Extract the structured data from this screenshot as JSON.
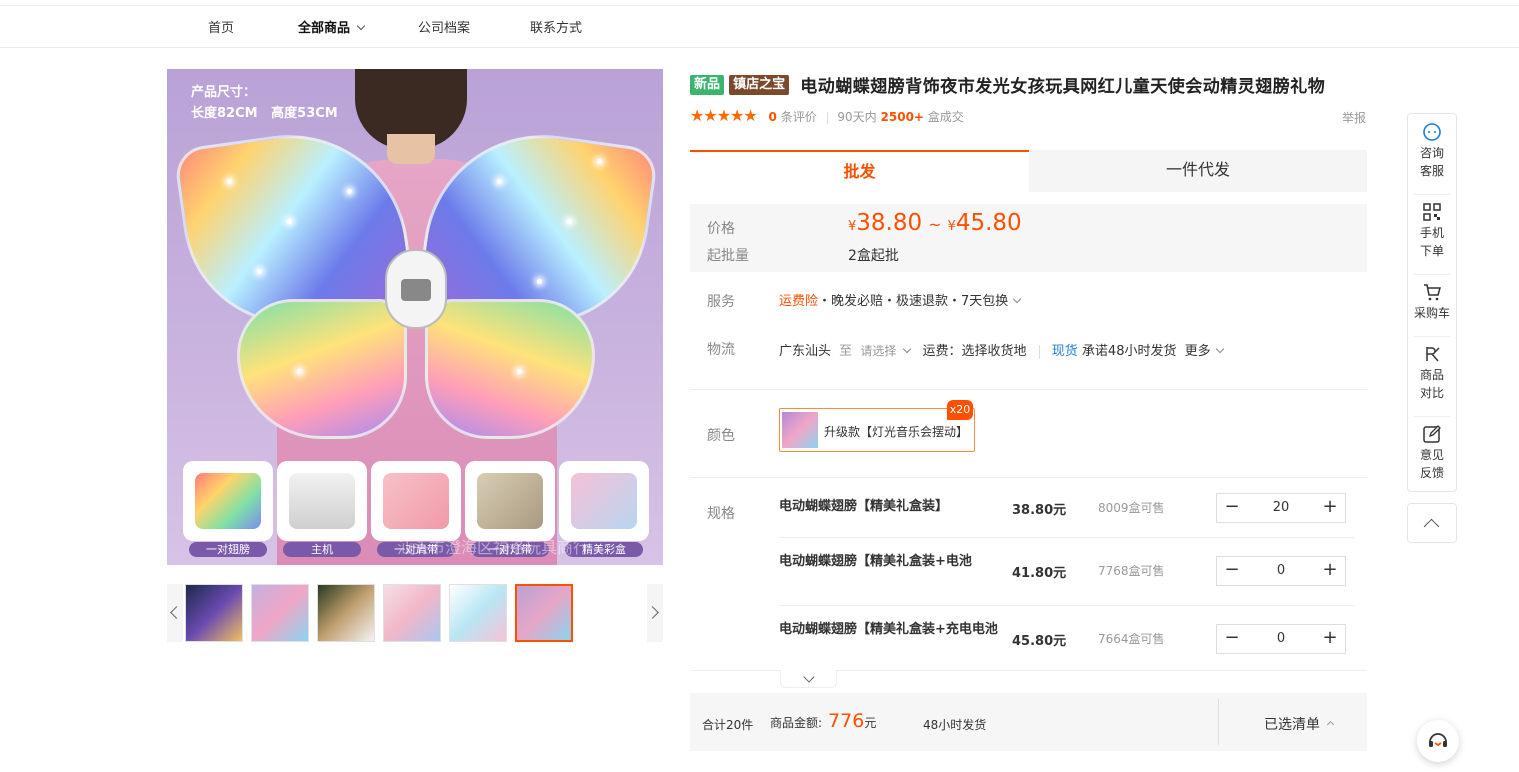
{
  "nav": {
    "items": [
      "首页",
      "全部商品",
      "公司档案",
      "联系方式"
    ]
  },
  "image": {
    "size_title": "产品尺寸：",
    "size_values": "长度82CM   高度53CM",
    "sub_labels": [
      "一对翅膀",
      "主机",
      "一对肩带",
      "一对灯带",
      "精美彩盒"
    ],
    "watermark": "汕头市澄海区福洛玩具商行"
  },
  "product": {
    "badge_new": "新品",
    "badge_treasure": "镇店之宝",
    "title": "电动蝴蝶翅膀背饰夜市发光女孩玩具网红儿童天使会动精灵翅膀礼物",
    "stars": "★★★★★",
    "review_count": "0",
    "review_label": "条评价",
    "sales_prefix": "90天内",
    "sales_count": "2500+",
    "sales_suffix": "盒成交",
    "report": "举报"
  },
  "tabs": [
    "批发",
    "一件代发"
  ],
  "price": {
    "label": "价格",
    "currency": "¥",
    "low": "38.80",
    "tilde": "~",
    "high": "45.80",
    "moq_label": "起批量",
    "moq_value": "2盒起批"
  },
  "service": {
    "label": "服务",
    "highlight": "运费险",
    "rest": "・晚发必赔・极速退款・7天包换"
  },
  "logistics": {
    "label": "物流",
    "origin": "广东汕头",
    "to": "至",
    "select": "请选择",
    "freight": "运费：选择收货地",
    "stock": "现货",
    "promise": "承诺48小时发货",
    "more": "更多"
  },
  "color": {
    "label": "颜色",
    "option": "升级款【灯光音乐会摆动】",
    "qty_badge": "x20"
  },
  "spec": {
    "label": "规格",
    "rows": [
      {
        "name": "电动蝴蝶翅膀【精美礼盒装】",
        "price": "38.80元",
        "stock": "8009盒可售",
        "qty": "20"
      },
      {
        "name": "电动蝴蝶翅膀【精美礼盒装+电池",
        "price": "41.80元",
        "stock": "7768盒可售",
        "qty": "0"
      },
      {
        "name": "电动蝴蝶翅膀【精美礼盒装+充电电池",
        "price": "45.80元",
        "stock": "7664盒可售",
        "qty": "0"
      }
    ],
    "minus": "−",
    "plus": "+"
  },
  "summary": {
    "total_items": "合计20件",
    "amount_label": "商品金额:",
    "amount": "776",
    "amount_unit": "元",
    "ship": "48小时发货",
    "cart_list": "已选清单"
  },
  "sidebar": {
    "items": [
      {
        "line1": "咨询",
        "line2": "客服"
      },
      {
        "line1": "手机",
        "line2": "下单"
      },
      {
        "line1": "采购车",
        "line2": ""
      },
      {
        "line1": "商品",
        "line2": "对比"
      },
      {
        "line1": "意见",
        "line2": "反馈"
      }
    ]
  },
  "colors": {
    "accent": "#ff5000",
    "badge_green": "#3bb46d",
    "badge_brown": "#7a4a2a",
    "link_blue": "#1c7fd6"
  }
}
